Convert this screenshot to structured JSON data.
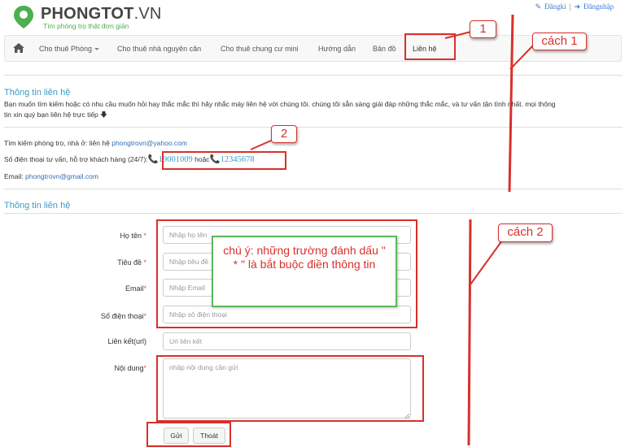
{
  "header": {
    "logo_main": "PHONGTOT",
    "logo_suffix": ".VN",
    "tagline": "Tìm phòng trọ thật đơn giản",
    "register": "Đăngkí",
    "login": "Đăngnhập"
  },
  "nav": {
    "items": [
      "Cho thuê Phòng",
      "Cho thuê nhà nguyên căn",
      "Cho thuê chung cư mini",
      "Hướng dẫn",
      "Bản đồ",
      "Liên hệ"
    ]
  },
  "section1": {
    "title": "Thông tin liên hệ",
    "intro1": "Bạn muốn tìm kiếm hoặc có nhu cầu muốn hỏi hay thắc mắc thì hãy nhắc máy liên hệ với chúng tôi. chúng tôi sẵn sàng giải đáp những thắc mắc, và tư vấn tận tình nhất. mọi thông",
    "intro2": "tin xin quý bạn liên hệ trực tiếp",
    "search_label": "Tìm kiếm phòng trọ, nhà ở: liên hệ",
    "search_email": "phongtrovn@yahoo.com",
    "phone_label": "Số điện thoại tư vấn, hỗ trợ khách hàng (24/7):",
    "phone1": "19001009",
    "or": "hoặc",
    "phone2": "12345678",
    "email_label": "Email:",
    "email": "phongtrovn@gmail.com"
  },
  "section2": {
    "title": "Thông tin liên hệ"
  },
  "form": {
    "name_label": "Họ tên",
    "name_ph": "Nhập họ tên",
    "subject_label": "Tiêu đề",
    "subject_ph": "Nhập tiêu đề",
    "email_label": "Email",
    "email_ph": "Nhập Email",
    "phone_label": "Số điện thoại",
    "phone_ph": "Nhập số điện thoại",
    "link_label": "Liên kết(url)",
    "link_ph": "Url liên kết",
    "content_label": "Nội dung",
    "content_ph": "nhập nội dung cần gửi",
    "asterisk": "*",
    "send": "Gửi",
    "exit": "Thoát"
  },
  "annotations": {
    "num1": "1",
    "num2": "2",
    "way1": "cách 1",
    "way2": "cách 2",
    "note": "chú ý: những trường đánh dấu \" * \" là bắt buộc điền thông tin"
  },
  "colors": {
    "accent": "#3c9bc5",
    "annotation_red": "#d9302b",
    "note_border": "#5cb85c",
    "logo_green": "#4caf50"
  }
}
